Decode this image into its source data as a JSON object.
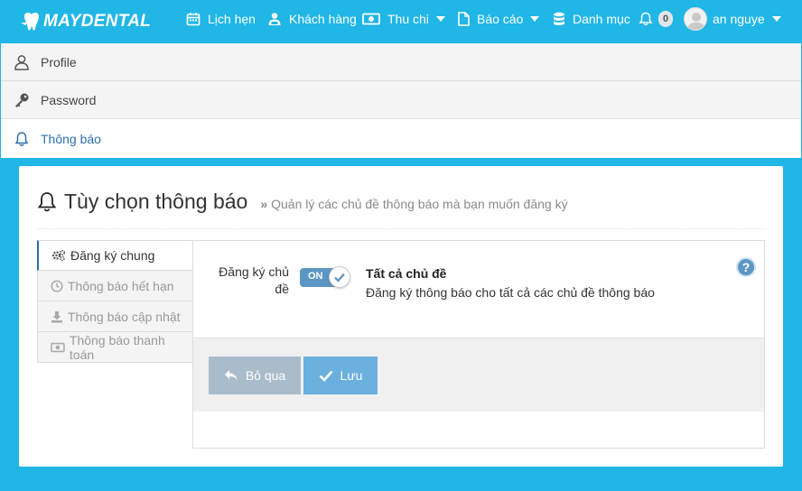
{
  "brand": {
    "logo_text": "MAYDENTAL"
  },
  "nav": {
    "items": [
      {
        "label": "Lịch hẹn",
        "icon": "calendar-icon"
      },
      {
        "label": "Khách hàng",
        "icon": "users-icon"
      },
      {
        "label": "Thu chi",
        "icon": "money-icon",
        "dropdown": true
      },
      {
        "label": "Báo cáo",
        "icon": "file-icon",
        "dropdown": true
      },
      {
        "label": "Danh mục",
        "icon": "database-icon"
      }
    ],
    "notifications": {
      "icon": "bell-icon",
      "count": "0"
    },
    "user": {
      "name": "an nguye",
      "icon": "avatar-icon"
    }
  },
  "settings_menu": {
    "items": [
      {
        "label": "Profile",
        "icon": "user-icon"
      },
      {
        "label": "Password",
        "icon": "key-icon"
      },
      {
        "label": "Thông báo",
        "icon": "bell-icon",
        "active": true
      }
    ]
  },
  "panel": {
    "title": "Tùy chọn thông báo",
    "subtitle": "Quản lý các chủ đề thông báo mà bạn muốn đăng ký",
    "tabs": [
      {
        "label": "Đăng ký chung",
        "icon": "cogs-icon",
        "active": true
      },
      {
        "label": "Thông báo hết hạn",
        "icon": "clock-icon"
      },
      {
        "label": "Thông báo cập nhật",
        "icon": "download-icon"
      },
      {
        "label": "Thông báo thanh toán",
        "icon": "money-icon"
      }
    ],
    "form": {
      "field_label": "Đăng ký chủ đề",
      "toggle_state": "ON",
      "option_title": "Tất cả chủ đề",
      "option_desc": "Đăng ký thông báo cho tất cả các chủ đề thông báo",
      "help_glyph": "?"
    },
    "buttons": {
      "cancel": "Bỏ qua",
      "save": "Lưu"
    }
  },
  "colors": {
    "brand_blue": "#20b6e6",
    "link_blue": "#2a6fad",
    "toggle_blue": "#5b96c4",
    "save_button": "#6ab0de",
    "cancel_button": "#a9bccc"
  }
}
